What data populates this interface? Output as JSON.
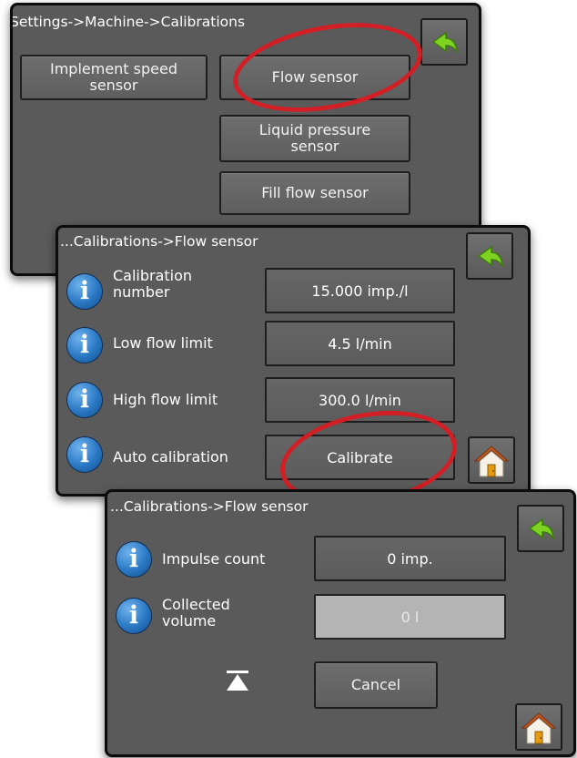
{
  "panel1": {
    "breadcrumb": "Settings->Machine->Calibrations",
    "buttons": {
      "implement_speed": "Implement speed sensor",
      "flow": "Flow sensor",
      "liquid_pressure": "Liquid pressure sensor",
      "fill_flow": "Fill flow sensor"
    },
    "back_icon": "back-arrow-icon"
  },
  "panel2": {
    "breadcrumb": "...Calibrations->Flow sensor",
    "rows": [
      {
        "label": "Calibration number",
        "value": "15.000 imp./l"
      },
      {
        "label": "Low flow limit",
        "value": "4.5 l/min"
      },
      {
        "label": "High flow limit",
        "value": "300.0 l/min"
      },
      {
        "label": "Auto calibration",
        "value": "Calibrate"
      }
    ],
    "back_icon": "back-arrow-icon",
    "home_icon": "home-icon"
  },
  "panel3": {
    "breadcrumb": "...Calibrations->Flow sensor",
    "rows": [
      {
        "label": "Impulse count",
        "value": "0 imp."
      },
      {
        "label": "Collected volume",
        "value": "0 l"
      }
    ],
    "cancel": "Cancel",
    "eject_icon": "eject-triangle-icon",
    "back_icon": "back-arrow-icon",
    "home_icon": "home-icon"
  },
  "colors": {
    "panel": "#5a5a5a",
    "annotation": "#d21f26",
    "info_blue": "#2a78c4",
    "back_green": "#7ed321"
  }
}
